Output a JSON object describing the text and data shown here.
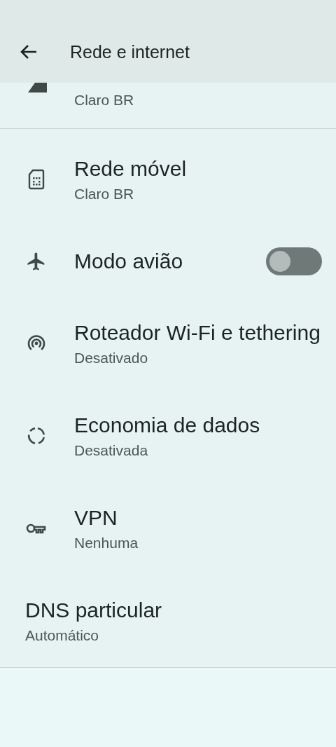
{
  "header": {
    "title": "Rede e internet"
  },
  "partial_item": {
    "subtitle": "Claro BR"
  },
  "items": [
    {
      "kind": "nav",
      "title": "Rede móvel",
      "subtitle": "Claro BR"
    },
    {
      "kind": "toggle",
      "title": "Modo avião",
      "on": false
    },
    {
      "kind": "nav",
      "title": "Roteador Wi-Fi e tethering",
      "subtitle": "Desativado"
    },
    {
      "kind": "nav",
      "title": "Economia de dados",
      "subtitle": "Desativada"
    },
    {
      "kind": "nav",
      "title": "VPN",
      "subtitle": "Nenhuma"
    },
    {
      "kind": "plain",
      "title": "DNS particular",
      "subtitle": "Automático"
    }
  ]
}
